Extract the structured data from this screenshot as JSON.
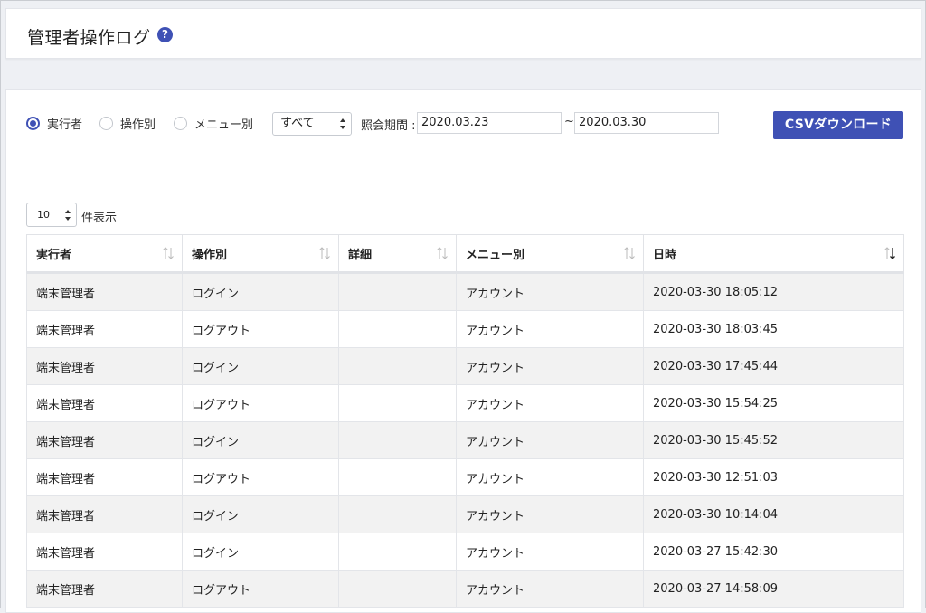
{
  "header": {
    "title": "管理者操作ログ",
    "help_icon": "?"
  },
  "filters": {
    "radios": [
      {
        "label": "実行者",
        "checked": true
      },
      {
        "label": "操作別",
        "checked": false
      },
      {
        "label": "メニュー別",
        "checked": false
      }
    ],
    "select_value": "すべて",
    "period_label": "照会期間 :",
    "date_from": "2020.03.23",
    "tilde": "~",
    "date_to": "2020.03.30",
    "csv_button": "CSVダウンロード"
  },
  "pagesize": {
    "value": "10",
    "label": "件表示"
  },
  "table": {
    "columns": [
      {
        "label": "実行者",
        "sort": "none"
      },
      {
        "label": "操作別",
        "sort": "none"
      },
      {
        "label": "詳細",
        "sort": "none"
      },
      {
        "label": "メニュー別",
        "sort": "none"
      },
      {
        "label": "日時",
        "sort": "desc"
      }
    ],
    "rows": [
      [
        "端末管理者",
        "ログイン",
        "",
        "アカウント",
        "2020-03-30 18:05:12"
      ],
      [
        "端末管理者",
        "ログアウト",
        "",
        "アカウント",
        "2020-03-30 18:03:45"
      ],
      [
        "端末管理者",
        "ログイン",
        "",
        "アカウント",
        "2020-03-30 17:45:44"
      ],
      [
        "端末管理者",
        "ログアウト",
        "",
        "アカウント",
        "2020-03-30 15:54:25"
      ],
      [
        "端末管理者",
        "ログイン",
        "",
        "アカウント",
        "2020-03-30 15:45:52"
      ],
      [
        "端末管理者",
        "ログアウト",
        "",
        "アカウント",
        "2020-03-30 12:51:03"
      ],
      [
        "端末管理者",
        "ログイン",
        "",
        "アカウント",
        "2020-03-30 10:14:04"
      ],
      [
        "端末管理者",
        "ログイン",
        "",
        "アカウント",
        "2020-03-27 15:42:30"
      ],
      [
        "端末管理者",
        "ログアウト",
        "",
        "アカウント",
        "2020-03-27 14:58:09"
      ]
    ]
  },
  "colors": {
    "accent": "#3f51b5",
    "row_stripe": "#f2f2f2",
    "background": "#eef0f4"
  }
}
